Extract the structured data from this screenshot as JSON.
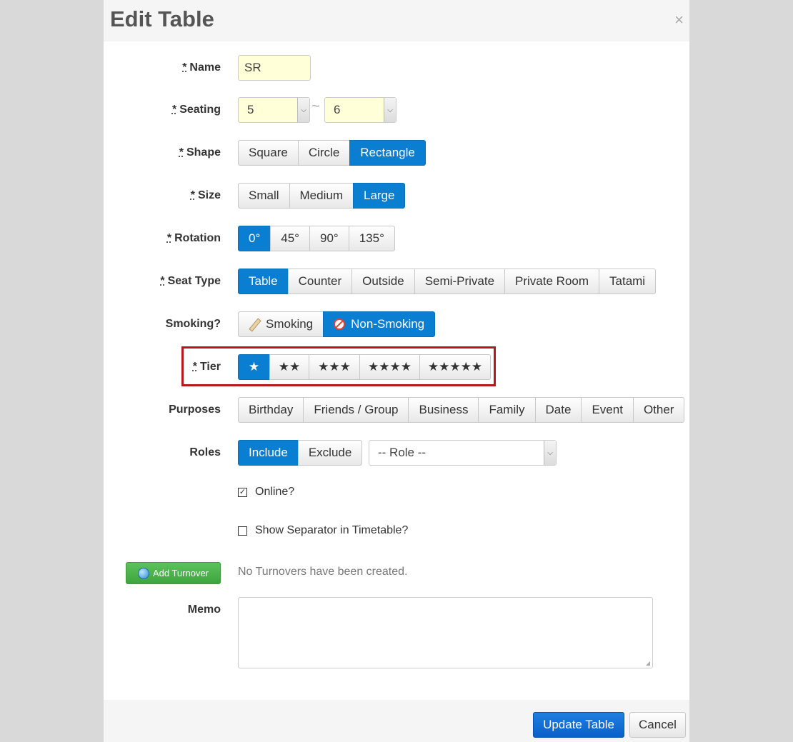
{
  "dialog": {
    "title": "Edit Table",
    "close_label": "×"
  },
  "form": {
    "name": {
      "label": "Name",
      "required": "*",
      "value": "SR"
    },
    "seating": {
      "label": "Seating",
      "required": "*",
      "min": "5",
      "separator": "~",
      "max": "6"
    },
    "shape": {
      "label": "Shape",
      "required": "*",
      "options": [
        "Square",
        "Circle",
        "Rectangle"
      ],
      "selected": "Rectangle"
    },
    "size": {
      "label": "Size",
      "required": "*",
      "options": [
        "Small",
        "Medium",
        "Large"
      ],
      "selected": "Large"
    },
    "rotation": {
      "label": "Rotation",
      "required": "*",
      "options": [
        "0°",
        "45°",
        "90°",
        "135°"
      ],
      "selected": "0°"
    },
    "seat_type": {
      "label": "Seat Type",
      "required": "*",
      "options": [
        "Table",
        "Counter",
        "Outside",
        "Semi-Private",
        "Private Room",
        "Tatami"
      ],
      "selected": "Table"
    },
    "smoking": {
      "label": "Smoking?",
      "options": [
        "Smoking",
        "Non-Smoking"
      ],
      "selected": "Non-Smoking"
    },
    "tier": {
      "label": "Tier",
      "required": "*",
      "options": [
        "★",
        "★★",
        "★★★",
        "★★★★",
        "★★★★★"
      ],
      "selected": "★"
    },
    "purposes": {
      "label": "Purposes",
      "options": [
        "Birthday",
        "Friends / Group",
        "Business",
        "Family",
        "Date",
        "Event",
        "Other"
      ]
    },
    "roles": {
      "label": "Roles",
      "options": [
        "Include",
        "Exclude"
      ],
      "selected": "Include",
      "role_select": "-- Role --"
    },
    "online": {
      "label": "Online?",
      "checked": true,
      "mark": "☑"
    },
    "separator": {
      "label": "Show Separator in Timetable?",
      "checked": false
    },
    "turnover": {
      "button_label": "Add Turnover",
      "note": "No Turnovers have been created."
    },
    "memo": {
      "label": "Memo",
      "value": ""
    }
  },
  "footer": {
    "update_label": "Update Table",
    "cancel_label": "Cancel"
  },
  "colors": {
    "active": "#0a7fd1",
    "highlight": "#b4191b",
    "input_bg": "#ffffd8",
    "success": "#4cb84c"
  },
  "icons": {
    "smoking": "cigarette-icon",
    "non_smoking": "no-smoking-icon",
    "turnover": "globe-icon",
    "close": "close-icon"
  }
}
